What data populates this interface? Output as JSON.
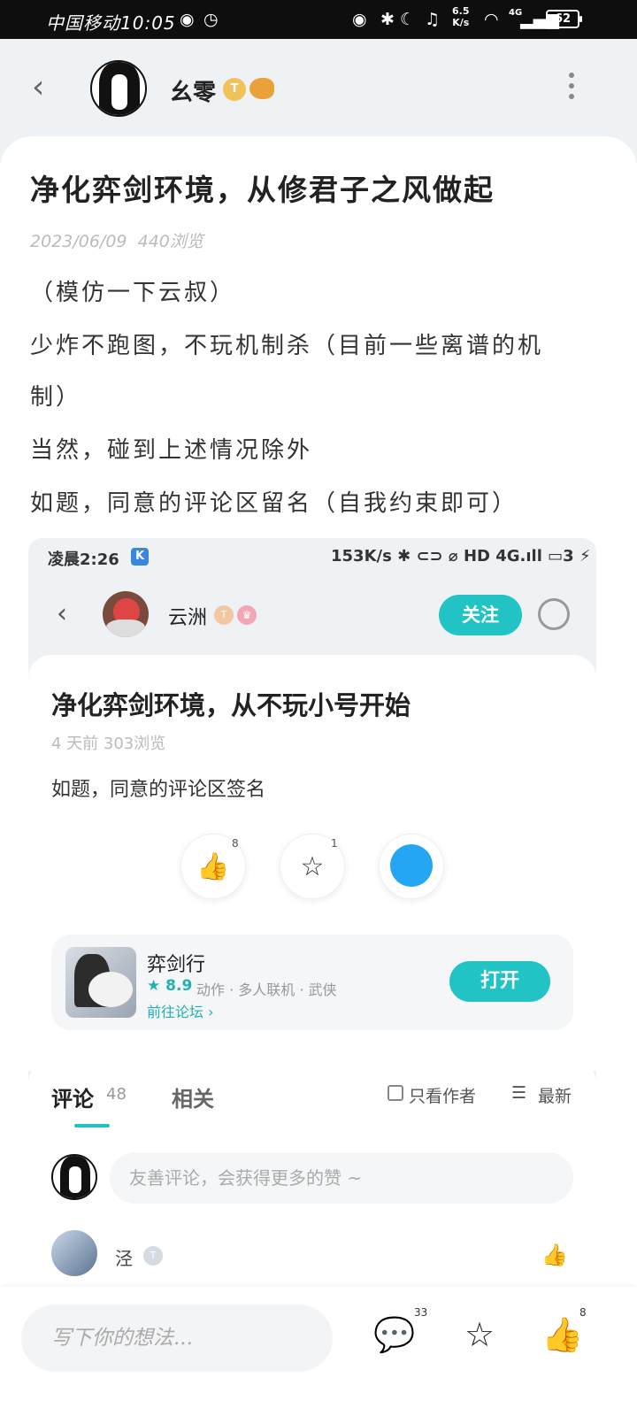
{
  "status_bar": {
    "carrier": "中国移动",
    "time": "10:05",
    "net_speed_top": "6.5",
    "net_speed_bottom": "K/s",
    "signal_label": "4G",
    "battery": "62"
  },
  "header": {
    "username": "幺零",
    "badge_label": "T"
  },
  "post": {
    "title": "净化弈剑环境，从修君子之风做起",
    "date": "2023/06/09",
    "views": "440浏览",
    "lines": [
      "（模仿一下云叔）",
      "少炸不跑图，不玩机制杀（目前一些离谱的机",
      "制）",
      "当然，碰到上述情况除外",
      "如题，同意的评论区留名（自我约束即可）"
    ]
  },
  "embedded": {
    "status_time": "凌晨2:26",
    "status_k": "K",
    "status_right": "153K/s ✱ ⊂⊃ ⌀ HD 4G.ıll ▭3 ⚡",
    "author": "云洲",
    "badge1": "T",
    "badge2": "♛",
    "follow_label": "关注",
    "title": "净化弈剑环境，从不玩小号开始",
    "meta": "4 天前   303浏览",
    "body": "如题，同意的评论区签名",
    "like_count": "8",
    "fav_count": "1",
    "game": {
      "name": "弈剑行",
      "rating": "★ 8.9",
      "tags": "动作 · 多人联机 · 武侠",
      "forum_link": "前往论坛 ›",
      "open_label": "打开"
    },
    "tabs": {
      "comments": "评论",
      "comments_count": "48",
      "related": "相关",
      "only_author": "只看作者",
      "sort": "最新"
    },
    "comment_placeholder": "友善评论，会获得更多的赞 ~",
    "commenter": "泾",
    "commenter_badge": "T"
  },
  "bottom_bar": {
    "placeholder": "写下你的想法...",
    "comment_count": "33",
    "like_count": "8"
  },
  "colors": {
    "accent": "#22c3c5",
    "header_bg": "#eef2f4"
  }
}
